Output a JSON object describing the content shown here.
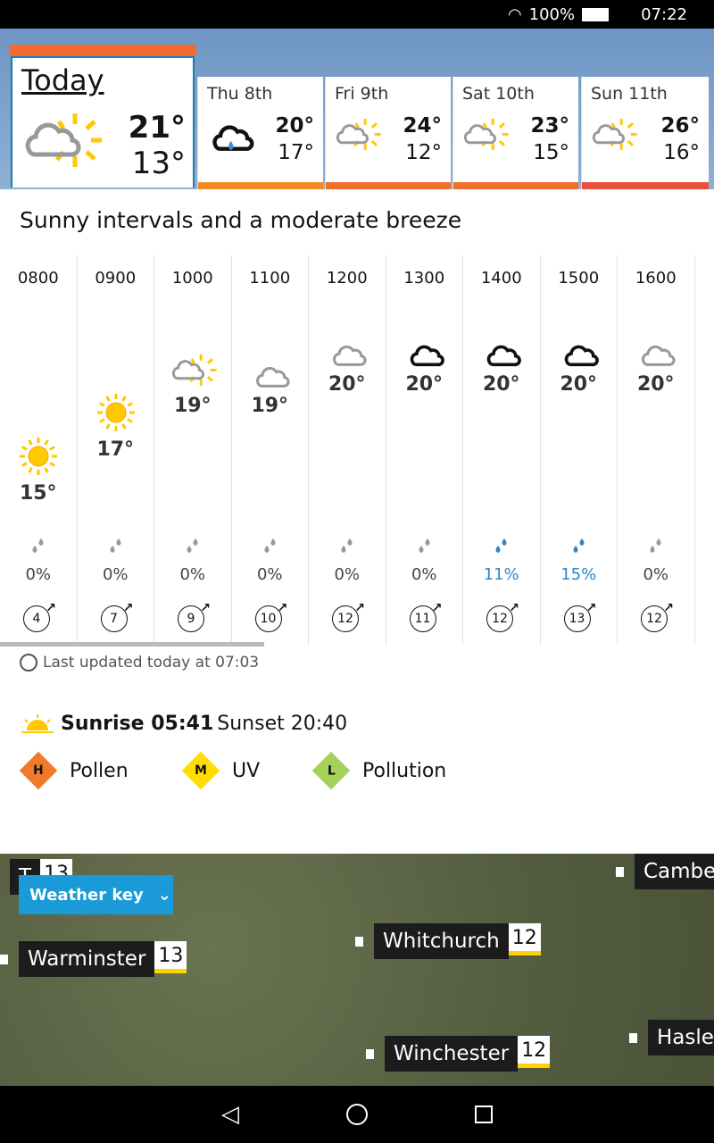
{
  "status": {
    "battery": "100%",
    "time": "07:22"
  },
  "today": {
    "label": "Today",
    "high": "21°",
    "low": "13°",
    "icon": "sun-cloud-icon"
  },
  "days": [
    {
      "label": "Thu 8th",
      "high": "20°",
      "low": "17°",
      "icon": "rain-cloud-icon",
      "color": "#f08a24"
    },
    {
      "label": "Fri 9th",
      "high": "24°",
      "low": "12°",
      "icon": "sun-cloud-icon",
      "color": "#f0702c"
    },
    {
      "label": "Sat 10th",
      "high": "23°",
      "low": "15°",
      "icon": "sun-cloud-icon",
      "color": "#f0702c"
    },
    {
      "label": "Sun 11th",
      "high": "26°",
      "low": "16°",
      "icon": "sun-cloud-icon",
      "color": "#e8503a"
    }
  ],
  "summary": "Sunny intervals and a moderate breeze",
  "hours": [
    {
      "time": "0800",
      "icon": "sun",
      "temp": 15,
      "temp_label": "15°",
      "rain": "0%",
      "wind": "4"
    },
    {
      "time": "0900",
      "icon": "sun",
      "temp": 17,
      "temp_label": "17°",
      "rain": "0%",
      "wind": "7"
    },
    {
      "time": "1000",
      "icon": "sun-cloud",
      "temp": 19,
      "temp_label": "19°",
      "rain": "0%",
      "wind": "9"
    },
    {
      "time": "1100",
      "icon": "cloud-grey",
      "temp": 19,
      "temp_label": "19°",
      "rain": "0%",
      "wind": "10"
    },
    {
      "time": "1200",
      "icon": "cloud-grey",
      "temp": 20,
      "temp_label": "20°",
      "rain": "0%",
      "wind": "12"
    },
    {
      "time": "1300",
      "icon": "cloud-black",
      "temp": 20,
      "temp_label": "20°",
      "rain": "0%",
      "wind": "11"
    },
    {
      "time": "1400",
      "icon": "cloud-black",
      "temp": 20,
      "temp_label": "20°",
      "rain": "11%",
      "wind": "12"
    },
    {
      "time": "1500",
      "icon": "cloud-black",
      "temp": 20,
      "temp_label": "20°",
      "rain": "15%",
      "wind": "13"
    },
    {
      "time": "1600",
      "icon": "cloud-grey",
      "temp": 20,
      "temp_label": "20°",
      "rain": "0%",
      "wind": "12"
    }
  ],
  "updated": "Last updated today at 07:03",
  "sunrise": "Sunrise 05:41",
  "sunset": "Sunset 20:40",
  "indices": [
    {
      "letter": "H",
      "label": "Pollen",
      "color": "#f07a2a"
    },
    {
      "letter": "M",
      "label": "UV",
      "color": "#ffdd00"
    },
    {
      "letter": "L",
      "label": "Pollution",
      "color": "#a6d15a"
    }
  ],
  "map": {
    "weather_key": "Weather key",
    "places": [
      {
        "name": "Warminster",
        "value": "13"
      },
      {
        "name": "Whitchurch",
        "value": "12"
      },
      {
        "name": "Winchester",
        "value": "12"
      },
      {
        "name": "Camber",
        "value": ""
      },
      {
        "name": "Hasle",
        "value": ""
      },
      {
        "name": "T",
        "value": "13"
      }
    ]
  }
}
